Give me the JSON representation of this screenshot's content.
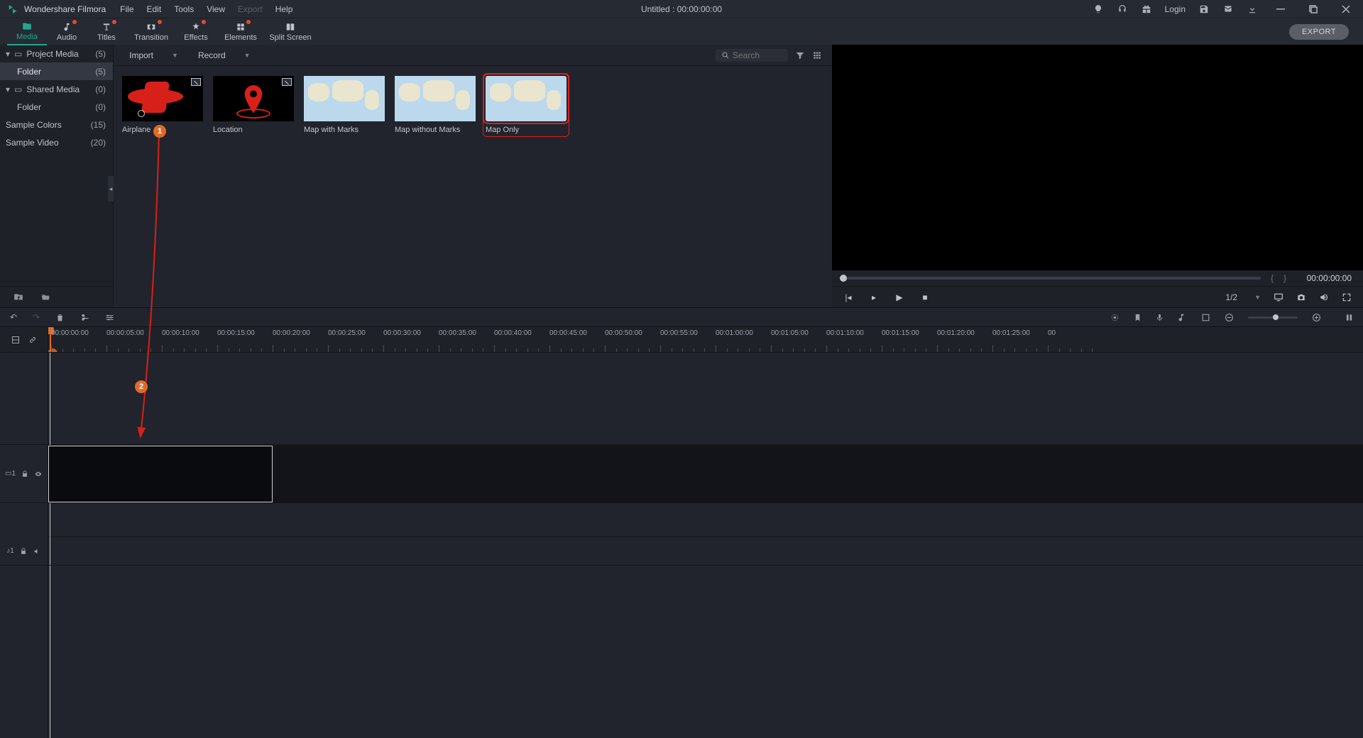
{
  "app": {
    "name": "Wondershare Filmora"
  },
  "menus": [
    "File",
    "Edit",
    "Tools",
    "View",
    "Export",
    "Help"
  ],
  "menu_disabled_index": 4,
  "title": "Untitled : 00:00:00:00",
  "title_actions": {
    "login": "Login"
  },
  "ribbon": [
    {
      "label": "Media",
      "active": true,
      "badge": false
    },
    {
      "label": "Audio",
      "active": false,
      "badge": true
    },
    {
      "label": "Titles",
      "active": false,
      "badge": true
    },
    {
      "label": "Transition",
      "active": false,
      "badge": true,
      "wide": true
    },
    {
      "label": "Effects",
      "active": false,
      "badge": true
    },
    {
      "label": "Elements",
      "active": false,
      "badge": true,
      "wide": true
    },
    {
      "label": "Split Screen",
      "active": false,
      "badge": false,
      "wide": true
    }
  ],
  "export_label": "EXPORT",
  "library": {
    "project_media": {
      "label": "Project Media",
      "count": "(5)"
    },
    "project_folder": {
      "label": "Folder",
      "count": "(5)"
    },
    "shared_media": {
      "label": "Shared Media",
      "count": "(0)"
    },
    "shared_folder": {
      "label": "Folder",
      "count": "(0)"
    },
    "sample_colors": {
      "label": "Sample Colors",
      "count": "(15)"
    },
    "sample_video": {
      "label": "Sample Video",
      "count": "(20)"
    }
  },
  "toolbar": {
    "import": "Import",
    "record": "Record",
    "search_placeholder": "Search"
  },
  "clips": [
    {
      "label": "Airplane",
      "kind": "plane",
      "badge": true
    },
    {
      "label": "Location",
      "kind": "loc",
      "badge": true
    },
    {
      "label": "Map with Marks",
      "kind": "map",
      "badge": false
    },
    {
      "label": "Map without Marks",
      "kind": "map",
      "badge": false
    },
    {
      "label": "Map Only",
      "kind": "map",
      "badge": false,
      "selected": true
    }
  ],
  "preview": {
    "time": "00:00:00:00",
    "scale": "1/2"
  },
  "ruler": {
    "labels": [
      "00:00:00:00",
      "00:00:05:00",
      "00:00:10:00",
      "00:00:15:00",
      "00:00:20:00",
      "00:00:25:00",
      "00:00:30:00",
      "00:00:35:00",
      "00:00:40:00",
      "00:00:45:00",
      "00:00:50:00",
      "00:00:55:00",
      "00:01:00:00",
      "00:01:05:00",
      "00:01:10:00",
      "00:01:15:00",
      "00:01:20:00",
      "00:01:25:00",
      "00"
    ]
  },
  "tracks": {
    "video": {
      "id": "1"
    },
    "audio": {
      "id": "1"
    }
  },
  "annotations": {
    "b1": "1",
    "b2": "2"
  }
}
